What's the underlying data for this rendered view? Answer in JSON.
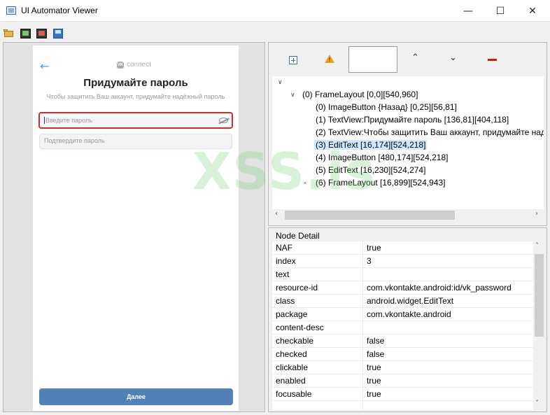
{
  "window": {
    "title": "UI Automator Viewer",
    "minimize": "—",
    "maximize": "☐",
    "close": "✕"
  },
  "toolbar": {
    "icons": [
      "folder-open-icon",
      "device-screenshot-icon",
      "device-screenshot-compressed-icon",
      "save-icon"
    ]
  },
  "device": {
    "back": "←",
    "brand": "connect",
    "brand_badge": "VK",
    "title": "Придумайте пароль",
    "subtitle": "Чтобы защитить Ваш аккаунт, придумайте надёжный пароль",
    "password_placeholder": "Введите пароль",
    "confirm_placeholder": "Подтвердите пароль",
    "next_button": "Далее",
    "highlight_color": "#d42a2a",
    "button_color": "#5181b8"
  },
  "hierarchy": {
    "root": "(0) FrameLayout [0,0][540,960]",
    "children": [
      "(0) ImageButton {Назад} [0,25][56,81]",
      "(1) TextView:Придумайте пароль [136,81][404,118]",
      "(2) TextView:Чтобы защитить Ваш аккаунт, придумайте над",
      "(3) EditText [16,174][524,218]",
      "(4) ImageButton [480,174][524,218]",
      "(5) EditText [16,230][524,274]",
      "(6) FrameLayout [16,899][524,943]"
    ],
    "selected_index": 3
  },
  "node_detail": {
    "title": "Node Detail",
    "rows": [
      {
        "key": "NAF",
        "value": "true"
      },
      {
        "key": "index",
        "value": "3"
      },
      {
        "key": "text",
        "value": ""
      },
      {
        "key": "resource-id",
        "value": "com.vkontakte.android:id/vk_password"
      },
      {
        "key": "class",
        "value": "android.widget.EditText"
      },
      {
        "key": "package",
        "value": "com.vkontakte.android"
      },
      {
        "key": "content-desc",
        "value": ""
      },
      {
        "key": "checkable",
        "value": "false"
      },
      {
        "key": "checked",
        "value": "false"
      },
      {
        "key": "clickable",
        "value": "true"
      },
      {
        "key": "enabled",
        "value": "true"
      },
      {
        "key": "focusable",
        "value": "true"
      }
    ]
  },
  "watermark": "XSS.is"
}
